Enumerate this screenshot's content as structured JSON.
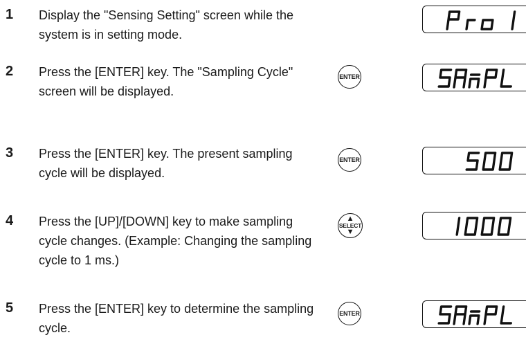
{
  "steps": [
    {
      "num": "1",
      "text": "Display the \"Sensing Setting\" screen while the system is in setting mode.",
      "key": "",
      "display": "Pro 1"
    },
    {
      "num": "2",
      "text": "Press the [ENTER] key. The \"Sampling Cycle\" screen will be displayed.",
      "key": "ENTER",
      "display": "SAMPL"
    },
    {
      "num": "3",
      "text": "Press the [ENTER] key. The present sampling cycle will be displayed.",
      "key": "ENTER",
      "display": "500"
    },
    {
      "num": "4",
      "text": "Press the [UP]/[DOWN] key to make sampling cycle changes. (Example: Changing the sampling cycle to 1 ms.)",
      "key": "SELECT",
      "display": "1000"
    },
    {
      "num": "5",
      "text": "Press the [ENTER] key to determine the sampling cycle.",
      "key": "ENTER",
      "display": "SAMPL"
    }
  ]
}
